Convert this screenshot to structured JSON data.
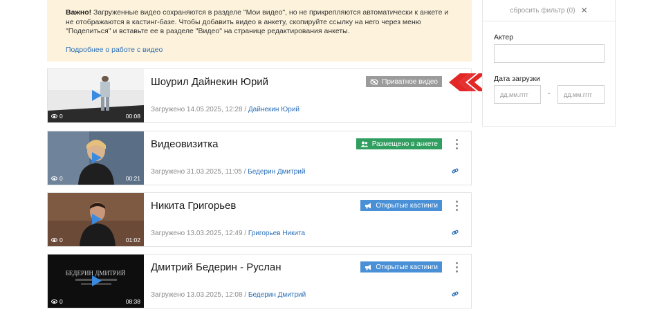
{
  "notice": {
    "bold": "Важно!",
    "text": " Загруженные видео сохраняются в разделе \"Мои видео\", но не прикрепляются автоматически к анкете и не отображаются в кастинг-базе. Чтобы добавить видео в анкету, скопируйте ссылку на него через меню \"Поделиться\" и вставьте ее в разделе \"Видео\" на странице редактирования анкеты.",
    "link": "Подробнее о работе с видео"
  },
  "filters": {
    "reset_label": "сбросить фильтр (0)",
    "actor_label": "Актер",
    "actor_value": "",
    "date_label": "Дата загрузки",
    "date_from_placeholder": "дд.мм.гггг",
    "date_to_placeholder": "дд.мм.гггг",
    "date_separator": "-"
  },
  "videos": [
    {
      "title": "Шоурил Дайнекин Юрий",
      "views": "0",
      "duration": "00:08",
      "uploaded": "Загружено 14.05.2025, 12:28 /",
      "author": "Дайнекин Юрий",
      "badge": "Приватное видео",
      "badge_color": "#9b9b9b",
      "badge_icon": "eye-slash-icon"
    },
    {
      "title": "Видеовизитка",
      "views": "0",
      "duration": "00:21",
      "uploaded": "Загружено 31.03.2025, 11:05 /",
      "author": "Бедерин Дмитрий",
      "badge": "Размещено в анкете",
      "badge_color": "#2f9e5f",
      "badge_icon": "users-icon"
    },
    {
      "title": "Никита Григорьев",
      "views": "0",
      "duration": "01:02",
      "uploaded": "Загружено 13.03.2025, 12:49 /",
      "author": "Григорьев Никита",
      "badge": "Открытые кастинги",
      "badge_color": "#4a90d6",
      "badge_icon": "megaphone-icon"
    },
    {
      "title": "Дмитрий Бедерин - Руслан",
      "views": "0",
      "duration": "08:38",
      "uploaded": "Загружено 13.03.2025, 12:08 /",
      "author": "Бедерин Дмитрий",
      "badge": "Открытые кастинги",
      "badge_color": "#4a90d6",
      "badge_icon": "megaphone-icon",
      "thumb_text": "БЕДЕРИН ДМИТРИЙ"
    }
  ]
}
